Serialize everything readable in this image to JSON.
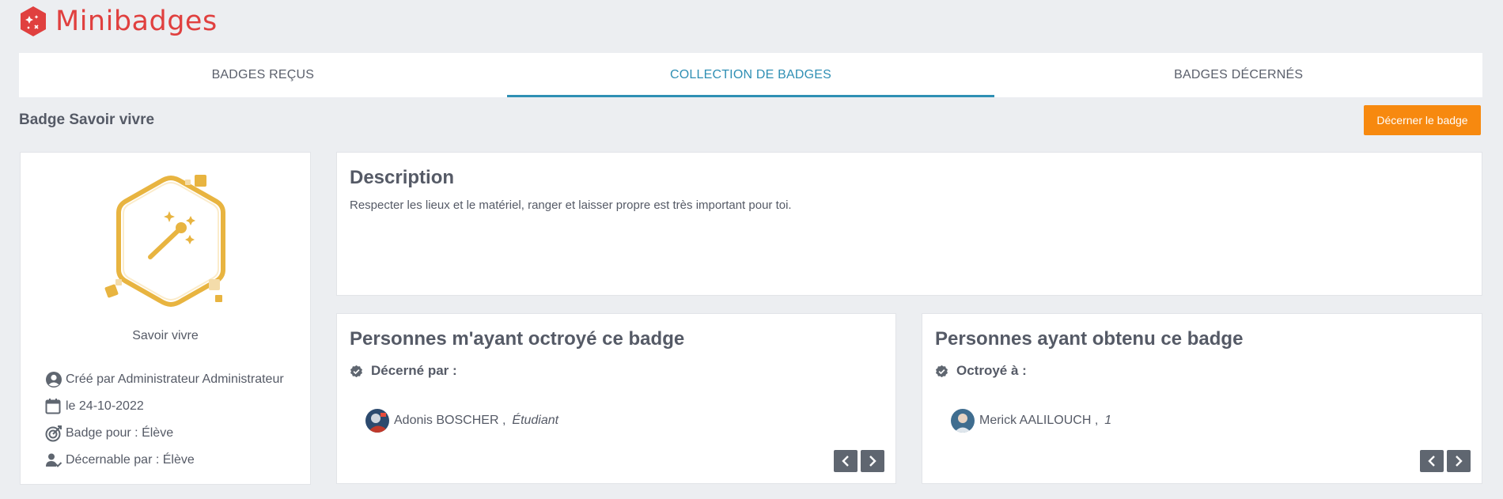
{
  "app": {
    "name": "Minibadges"
  },
  "tabs": [
    {
      "label": "BADGES REÇUS"
    },
    {
      "label": "COLLECTION DE BADGES",
      "active": true
    },
    {
      "label": "BADGES DÉCERNÉS"
    }
  ],
  "page": {
    "title": "Badge Savoir vivre",
    "award_button": "Décerner le badge"
  },
  "badge": {
    "name": "Savoir vivre",
    "icon": "magic-wand-hexagon",
    "color": "#e8b440",
    "meta": {
      "created_by": "Créé par Administrateur Administrateur",
      "date": "le 24-10-2022",
      "for": "Badge pour : Élève",
      "awardable_by": "Décernable par : Élève"
    }
  },
  "description": {
    "title": "Description",
    "text": "Respecter les lieux et le matériel, ranger et laisser propre est très important pour toi."
  },
  "granted_by": {
    "title": "Personnes m'ayant octroyé ce badge",
    "label": "Décerné par :",
    "people": [
      {
        "name": "Adonis BOSCHER ,",
        "role": "Étudiant"
      }
    ]
  },
  "obtained_by": {
    "title": "Personnes ayant obtenu ce badge",
    "label": "Octroyé à :",
    "people": [
      {
        "name": "Merick AALILOUCH ,",
        "role": "1"
      }
    ]
  },
  "colors": {
    "brand": "#e0403f",
    "accent": "#2f8fb4",
    "button": "#f7890f",
    "pager": "#5f6670"
  }
}
